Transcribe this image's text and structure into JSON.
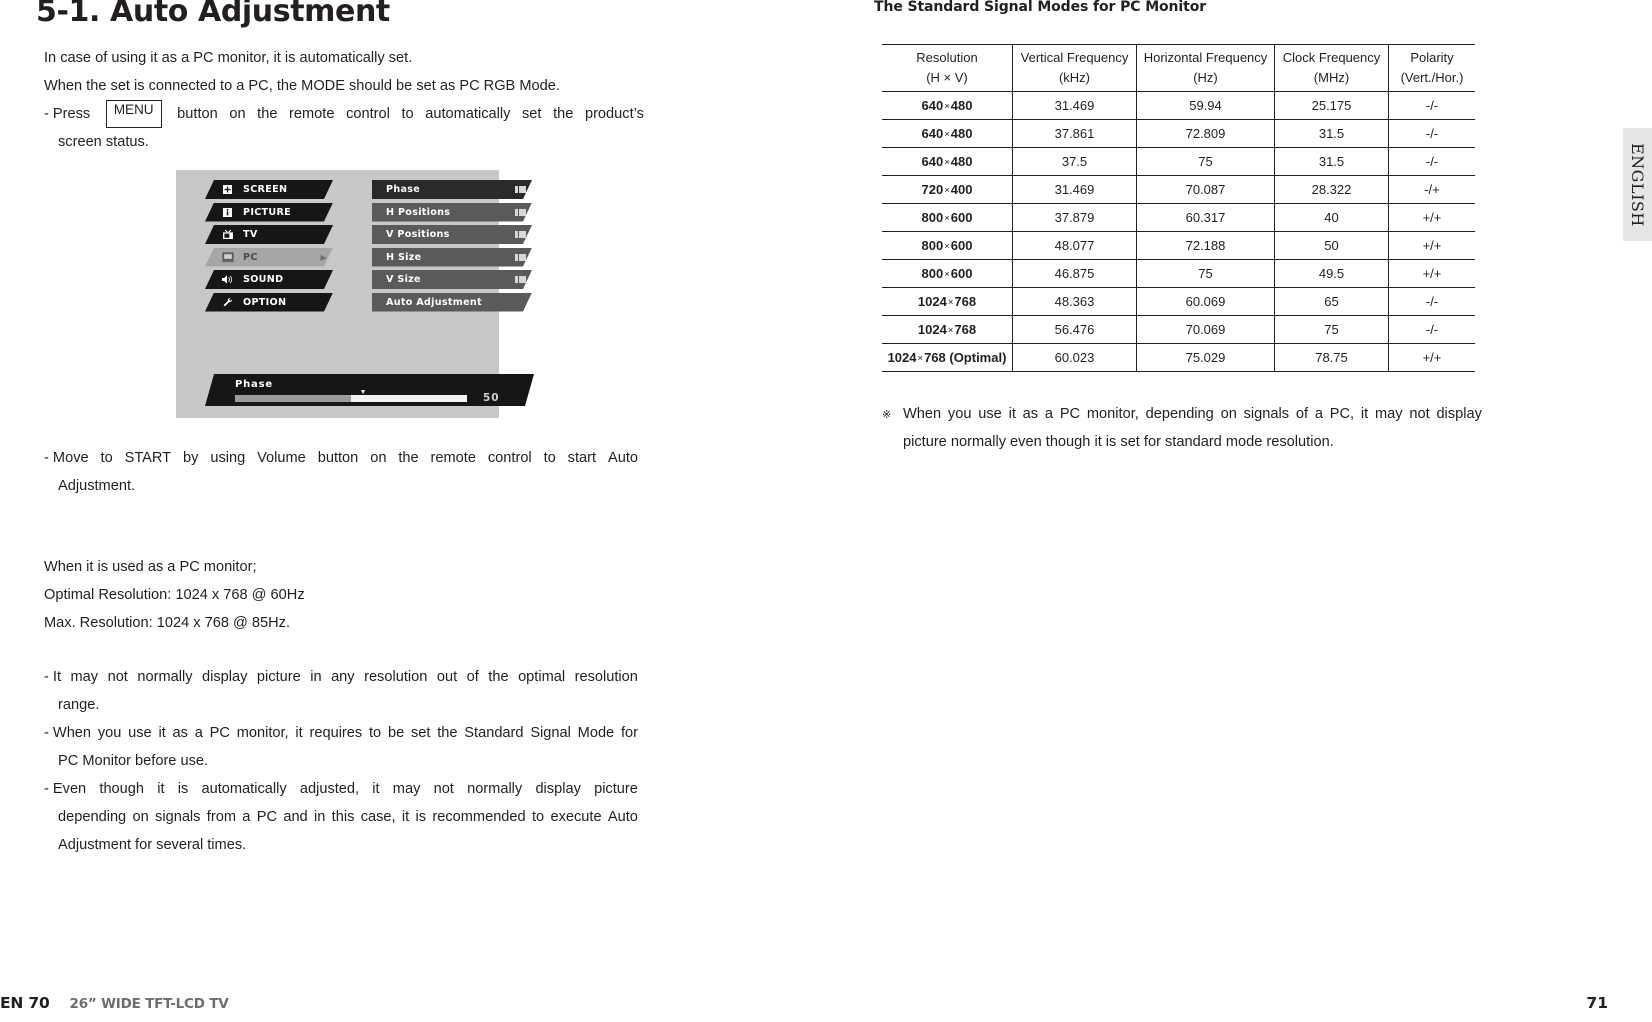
{
  "left": {
    "title": "5-1. Auto Adjustment",
    "intro": [
      "In case of using it as a PC monitor, it is automatically set.",
      "When the set is connected to a PC, the MODE should be set as PC RGB Mode."
    ],
    "press_prefix": "- Press",
    "menu_key": "MENU",
    "press_line1_words": [
      "button",
      "on",
      "the",
      "remote",
      "control",
      "to",
      "automatically",
      "set",
      "the",
      "product’s"
    ],
    "press_line2": "screen status.",
    "osd": {
      "left_menu": [
        {
          "label": "SCREEN",
          "icon": "screen-icon",
          "selected": false
        },
        {
          "label": "PICTURE",
          "icon": "picture-icon",
          "selected": false
        },
        {
          "label": "TV",
          "icon": "tv-icon",
          "selected": false
        },
        {
          "label": "PC",
          "icon": "pc-icon",
          "selected": true
        },
        {
          "label": "SOUND",
          "icon": "speaker-icon",
          "selected": false
        },
        {
          "label": "OPTION",
          "icon": "wrench-icon",
          "selected": false
        }
      ],
      "right_menu": [
        {
          "label": "Phase",
          "bars": true,
          "dark": true
        },
        {
          "label": "H Positions",
          "bars": true,
          "dark": false
        },
        {
          "label": "V Positions",
          "bars": true,
          "dark": false
        },
        {
          "label": "H Size",
          "bars": true,
          "dark": false
        },
        {
          "label": "V Size",
          "bars": true,
          "dark": false
        },
        {
          "label": "Auto Adjustment",
          "bars": false,
          "dark": false
        }
      ],
      "slider": {
        "label": "Phase",
        "value": "50",
        "fill_percent": 50
      }
    },
    "para_move": {
      "line1_words": [
        "- Move",
        "to",
        "START",
        "by",
        "using",
        "Volume",
        "button",
        "on",
        "the",
        "remote",
        "control",
        "to",
        "start",
        "Auto"
      ],
      "line2": "Adjustment."
    },
    "resolution_info": [
      "When it is used as a PC monitor;",
      "Optimal Resolution: 1024 x 768 @ 60Hz",
      "Max. Resolution: 1024 x 768 @ 85Hz."
    ],
    "bullets": [
      {
        "line1_words": [
          "- It",
          "may",
          "not",
          "normally",
          "display",
          "picture",
          "in",
          "any",
          "resolution",
          "out",
          "of",
          "the",
          "optimal",
          "resolution"
        ],
        "rest": [
          "range."
        ]
      },
      {
        "line1_words": [
          "- When",
          "you",
          "use",
          "it",
          "as",
          "a",
          "PC",
          "monitor,",
          "it",
          "requires",
          "to",
          "be",
          "set",
          "the",
          "Standard",
          "Signal",
          "Mode",
          "for"
        ],
        "rest": [
          "PC Monitor before use."
        ]
      },
      {
        "line1_words": [
          "- Even",
          "though",
          "it",
          "is",
          "automatically",
          "adjusted,",
          "it",
          "may",
          "not",
          "normally",
          "display",
          "picture"
        ],
        "rest_words": [
          [
            "depending",
            "on",
            "signals",
            "from",
            "a",
            "PC",
            "and",
            "in",
            "this",
            "case,",
            "it",
            "is",
            "recommended",
            "to",
            "execute",
            "Auto"
          ]
        ],
        "rest": [
          "Adjustment for several times."
        ]
      }
    ],
    "footer": {
      "page_code": "EN 70",
      "model": "26” WIDE TFT-LCD TV"
    }
  },
  "right": {
    "table_heading": "The Standard Signal Modes for PC Monitor",
    "table": {
      "headers": [
        {
          "line1": "Resolution",
          "line2": "(H × V)"
        },
        {
          "line1": "Vertical Frequency",
          "line2": "(kHz)"
        },
        {
          "line1": "Horizontal Frequency",
          "line2": "(Hz)"
        },
        {
          "line1": "Clock Frequency",
          "line2": "(MHz)"
        },
        {
          "line1": "Polarity",
          "line2": "(Vert./Hor.)"
        }
      ],
      "rows": [
        {
          "res_h": "640",
          "res_v": "480",
          "vf": "31.469",
          "hf": "59.94",
          "cf": "25.175",
          "pol": "-/-"
        },
        {
          "res_h": "640",
          "res_v": "480",
          "vf": "37.861",
          "hf": "72.809",
          "cf": "31.5",
          "pol": "-/-"
        },
        {
          "res_h": "640",
          "res_v": "480",
          "vf": "37.5",
          "hf": "75",
          "cf": "31.5",
          "pol": "-/-"
        },
        {
          "res_h": "720",
          "res_v": "400",
          "vf": "31.469",
          "hf": "70.087",
          "cf": "28.322",
          "pol": "-/+"
        },
        {
          "res_h": "800",
          "res_v": "600",
          "vf": "37.879",
          "hf": "60.317",
          "cf": "40",
          "pol": "+/+"
        },
        {
          "res_h": "800",
          "res_v": "600",
          "vf": "48.077",
          "hf": "72.188",
          "cf": "50",
          "pol": "+/+"
        },
        {
          "res_h": "800",
          "res_v": "600",
          "vf": "46.875",
          "hf": "75",
          "cf": "49.5",
          "pol": "+/+"
        },
        {
          "res_h": "1024",
          "res_v": "768",
          "vf": "48.363",
          "hf": "60.069",
          "cf": "65",
          "pol": "-/-"
        },
        {
          "res_h": "1024",
          "res_v": "768",
          "vf": "56.476",
          "hf": "70.069",
          "cf": "75",
          "pol": "-/-"
        },
        {
          "res_h": "1024",
          "res_v": "768 (Optimal)",
          "vf": "60.023",
          "hf": "75.029",
          "cf": "78.75",
          "pol": "+/+"
        }
      ]
    },
    "note": {
      "mark": "※",
      "line1_words": [
        "When",
        "you",
        "use",
        "it",
        "as",
        "a",
        "PC",
        "monitor,",
        "depending",
        "on",
        "signals",
        "of",
        "a",
        "PC,",
        "it",
        "may",
        "not",
        "display"
      ],
      "line2": "picture normally even though it is set for standard mode resolution."
    },
    "english_tab": "ENGLISH",
    "footer": {
      "page_number": "71"
    }
  }
}
